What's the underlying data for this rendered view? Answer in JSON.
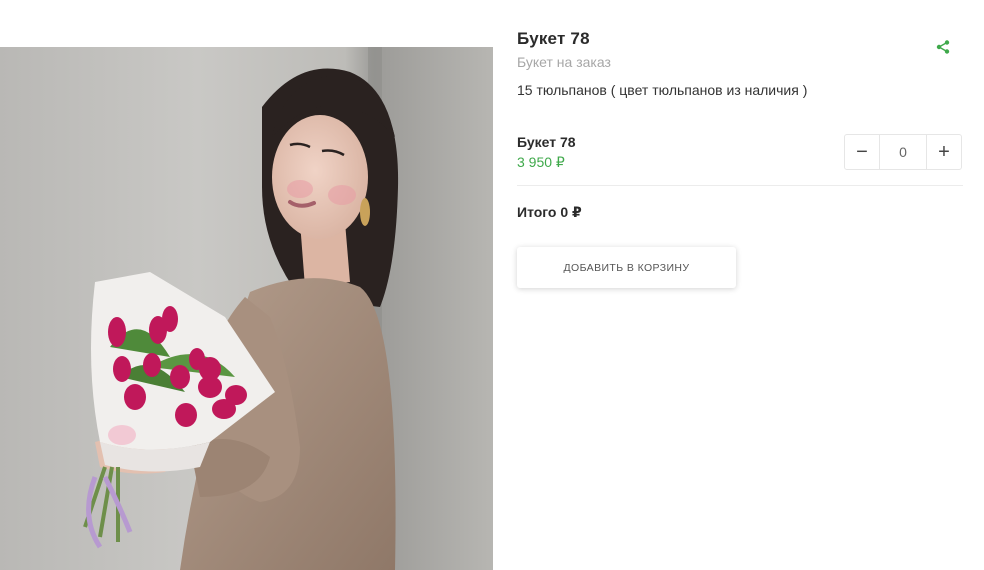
{
  "product": {
    "title": "Букет 78",
    "subtitle": "Букет на заказ",
    "description": "15 тюльпанов ( цвет тюльпанов из наличия )",
    "image_alt": "product-photo",
    "share_icon": "share-icon"
  },
  "variant": {
    "name": "Букет 78",
    "price": "3 950 ₽"
  },
  "quantity": {
    "minus_label": "−",
    "value": "0",
    "plus_label": "+"
  },
  "total": {
    "label": "Итого 0 ₽"
  },
  "actions": {
    "add_to_cart_label": "ДОБАВИТЬ В КОРЗИНУ"
  },
  "colors": {
    "accent_green": "#3fa94b",
    "tulip": "#c0185a",
    "dress": "#a68d7c"
  }
}
